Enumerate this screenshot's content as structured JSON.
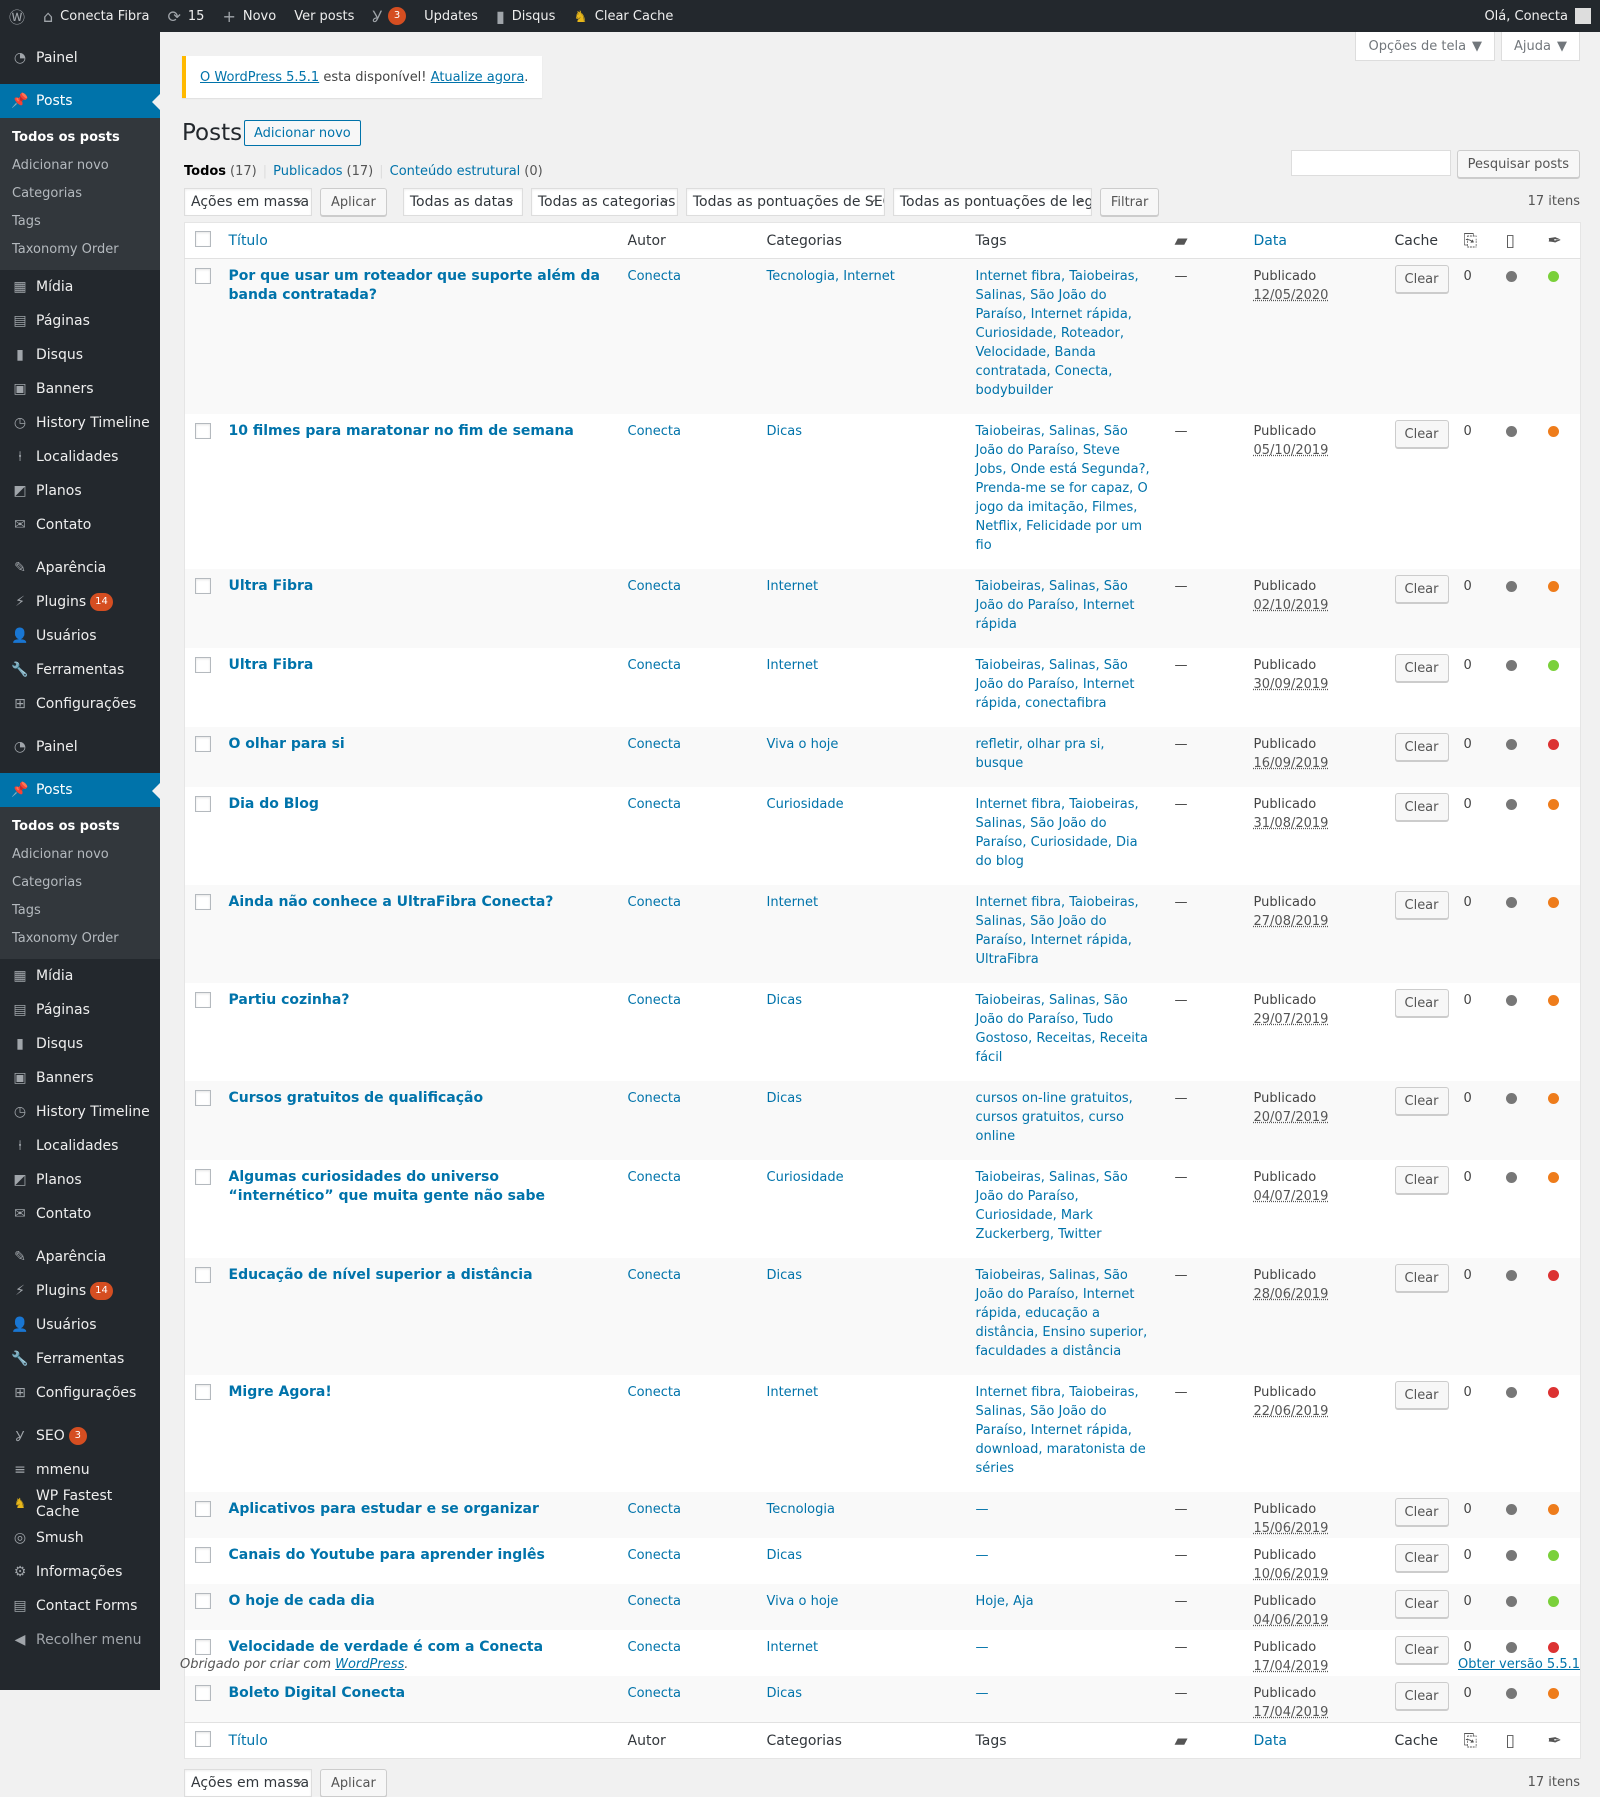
{
  "admin_bar": {
    "site_name": "Conecta Fibra",
    "updates_count": "15",
    "new_label": "Novo",
    "view_posts": "Ver posts",
    "yoast_badge": "3",
    "updates_label": "Updates",
    "disqus_label": "Disqus",
    "clear_cache": "Clear Cache",
    "greeting": "Olá, Conecta"
  },
  "sidebar": {
    "group1": [
      {
        "label": "Painel",
        "icon": "dashboard-icon"
      },
      {
        "label": "Posts",
        "icon": "pin-icon",
        "active": true
      }
    ],
    "posts_sub": [
      "Todos os posts",
      "Adicionar novo",
      "Categorias",
      "Tags",
      "Taxonomy Order"
    ],
    "group2": [
      "Mídia",
      "Páginas",
      "Disqus",
      "Banners",
      "History Timeline",
      "Localidades",
      "Planos",
      "Contato"
    ],
    "group3": [
      "Aparência",
      "Plugins",
      "Usuários",
      "Ferramentas",
      "Configurações"
    ],
    "plugins_badge": "14",
    "group5": [
      "SEO",
      "mmenu",
      "WP Fastest Cache",
      "Smush",
      "Informações",
      "Contact Forms"
    ],
    "seo_badge": "3",
    "collapse": "Recolher menu"
  },
  "screen_options": "Opções de tela",
  "help": "Ajuda",
  "notice": {
    "link1": "O WordPress 5.5.1",
    "text": " esta disponível! ",
    "link2": "Atualize agora",
    "end": "."
  },
  "page": {
    "title": "Posts",
    "add_new": "Adicionar novo"
  },
  "filters": {
    "all": "Todos",
    "all_count": "(17)",
    "published": "Publicados",
    "published_count": "(17)",
    "structural": "Conteúdo estrutural",
    "structural_count": "(0)"
  },
  "search": {
    "button": "Pesquisar posts"
  },
  "tablenav": {
    "bulk": "Ações em massa",
    "apply": "Aplicar",
    "dates": "Todas as datas",
    "categories": "Todas as categorias",
    "seo_scores": "Todas as pontuações de SEO",
    "read_scores": "Todas as pontuações de legibilidade",
    "filter": "Filtrar",
    "items": "17 itens"
  },
  "columns": {
    "title": "Título",
    "author": "Autor",
    "categories": "Categorias",
    "tags": "Tags",
    "date": "Data",
    "cache": "Cache"
  },
  "clear_label": "Clear",
  "status_label": "Publicado",
  "colors": {
    "gray": "#777777",
    "green": "#7ad03a",
    "orange": "#ee7c1b",
    "red": "#dc3232"
  },
  "posts": [
    {
      "title": "Por que usar um roteador que suporte além da banda contratada?",
      "author": "Conecta",
      "categories": "Tecnologia, Internet",
      "tags": "Internet fibra, Taiobeiras, Salinas, São João do Paraíso, Internet rápida, Curiosidade, Roteador, Velocidade, Banda contratada, Conecta, bodybuilder",
      "comments": "—",
      "date": "12/05/2020",
      "count": "0",
      "read": "gray",
      "seo": "green"
    },
    {
      "title": "10 filmes para maratonar no fim de semana",
      "author": "Conecta",
      "categories": "Dicas",
      "tags": "Taiobeiras, Salinas, São João do Paraíso, Steve Jobs, Onde está Segunda?, Prenda-me se for capaz, O jogo da imitação, Filmes, Netflix, Felicidade por um fio",
      "comments": "—",
      "date": "05/10/2019",
      "count": "0",
      "read": "gray",
      "seo": "orange"
    },
    {
      "title": "Ultra Fibra",
      "author": "Conecta",
      "categories": "Internet",
      "tags": "Taiobeiras, Salinas, São João do Paraíso, Internet rápida",
      "comments": "—",
      "date": "02/10/2019",
      "count": "0",
      "read": "gray",
      "seo": "orange"
    },
    {
      "title": "Ultra Fibra",
      "author": "Conecta",
      "categories": "Internet",
      "tags": "Taiobeiras, Salinas, São João do Paraíso, Internet rápida, conectafibra",
      "comments": "—",
      "date": "30/09/2019",
      "count": "0",
      "read": "gray",
      "seo": "green"
    },
    {
      "title": "O olhar para si",
      "author": "Conecta",
      "categories": "Viva o hoje",
      "tags": "refletir, olhar pra si, busque",
      "comments": "—",
      "date": "16/09/2019",
      "count": "0",
      "read": "gray",
      "seo": "red"
    },
    {
      "title": "Dia do Blog",
      "author": "Conecta",
      "categories": "Curiosidade",
      "tags": "Internet fibra, Taiobeiras, Salinas, São João do Paraíso, Curiosidade, Dia do blog",
      "comments": "—",
      "date": "31/08/2019",
      "count": "0",
      "read": "gray",
      "seo": "orange"
    },
    {
      "title": "Ainda não conhece a UltraFibra Conecta?",
      "author": "Conecta",
      "categories": "Internet",
      "tags": "Internet fibra, Taiobeiras, Salinas, São João do Paraíso, Internet rápida, UltraFibra",
      "comments": "—",
      "date": "27/08/2019",
      "count": "0",
      "read": "gray",
      "seo": "orange"
    },
    {
      "title": "Partiu cozinha?",
      "author": "Conecta",
      "categories": "Dicas",
      "tags": "Taiobeiras, Salinas, São João do Paraíso, Tudo Gostoso, Receitas, Receita fácil",
      "comments": "—",
      "date": "29/07/2019",
      "count": "0",
      "read": "gray",
      "seo": "orange"
    },
    {
      "title": "Cursos gratuitos de qualificação",
      "author": "Conecta",
      "categories": "Dicas",
      "tags": "cursos on-line gratuitos, cursos gratuitos, curso online",
      "comments": "—",
      "date": "20/07/2019",
      "count": "0",
      "read": "gray",
      "seo": "orange"
    },
    {
      "title": "Algumas curiosidades do universo “internético” que muita gente não sabe",
      "author": "Conecta",
      "categories": "Curiosidade",
      "tags": "Taiobeiras, Salinas, São João do Paraíso, Curiosidade, Mark Zuckerberg, Twitter",
      "comments": "—",
      "date": "04/07/2019",
      "count": "0",
      "read": "gray",
      "seo": "orange"
    },
    {
      "title": "Educação de nível superior a distância",
      "author": "Conecta",
      "categories": "Dicas",
      "tags": "Taiobeiras, Salinas, São João do Paraíso, Internet rápida, educação a distância, Ensino superior, faculdades a distância",
      "comments": "—",
      "date": "28/06/2019",
      "count": "0",
      "read": "gray",
      "seo": "red"
    },
    {
      "title": "Migre Agora!",
      "author": "Conecta",
      "categories": "Internet",
      "tags": "Internet fibra, Taiobeiras, Salinas, São João do Paraíso, Internet rápida, download, maratonista de séries",
      "comments": "—",
      "date": "22/06/2019",
      "count": "0",
      "read": "gray",
      "seo": "red"
    },
    {
      "title": "Aplicativos para estudar e se organizar",
      "author": "Conecta",
      "categories": "Tecnologia",
      "tags": "—",
      "comments": "—",
      "date": "15/06/2019",
      "count": "0",
      "read": "gray",
      "seo": "orange"
    },
    {
      "title": "Canais do Youtube para aprender inglês",
      "author": "Conecta",
      "categories": "Dicas",
      "tags": "—",
      "comments": "—",
      "date": "10/06/2019",
      "count": "0",
      "read": "gray",
      "seo": "green"
    },
    {
      "title": "O hoje de cada dia",
      "author": "Conecta",
      "categories": "Viva o hoje",
      "tags": "Hoje, Aja",
      "comments": "—",
      "date": "04/06/2019",
      "count": "0",
      "read": "gray",
      "seo": "green"
    },
    {
      "title": "Velocidade de verdade é com a Conecta",
      "author": "Conecta",
      "categories": "Internet",
      "tags": "—",
      "comments": "—",
      "date": "17/04/2019",
      "count": "0",
      "read": "gray",
      "seo": "red"
    },
    {
      "title": "Boleto Digital Conecta",
      "author": "Conecta",
      "categories": "Dicas",
      "tags": "—",
      "comments": "—",
      "date": "17/04/2019",
      "count": "0",
      "read": "gray",
      "seo": "orange"
    }
  ],
  "footer": {
    "thanks": "Obrigado por criar com ",
    "wp": "WordPress",
    "dot": ".",
    "version": "Obter versão 5.5.1"
  }
}
